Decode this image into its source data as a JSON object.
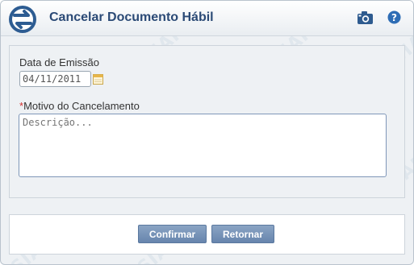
{
  "header": {
    "title": "Cancelar Documento Hábil",
    "logo_icon": "siafi-logo-icon",
    "camera_icon": "camera-icon",
    "help_icon": "help-icon"
  },
  "watermark": {
    "text": "SIAFI"
  },
  "form": {
    "date_label": "Data de Emissão",
    "date_value": "04/11/2011",
    "calendar_icon": "calendar-icon",
    "motivo_required_mark": "*",
    "motivo_label": "Motivo do Cancelamento",
    "motivo_placeholder": "Descrição..."
  },
  "buttons": {
    "confirm_label": "Confirmar",
    "return_label": "Retornar"
  },
  "colors": {
    "title": "#2b4a76",
    "button": "#6f8db3",
    "required": "#d23030"
  }
}
